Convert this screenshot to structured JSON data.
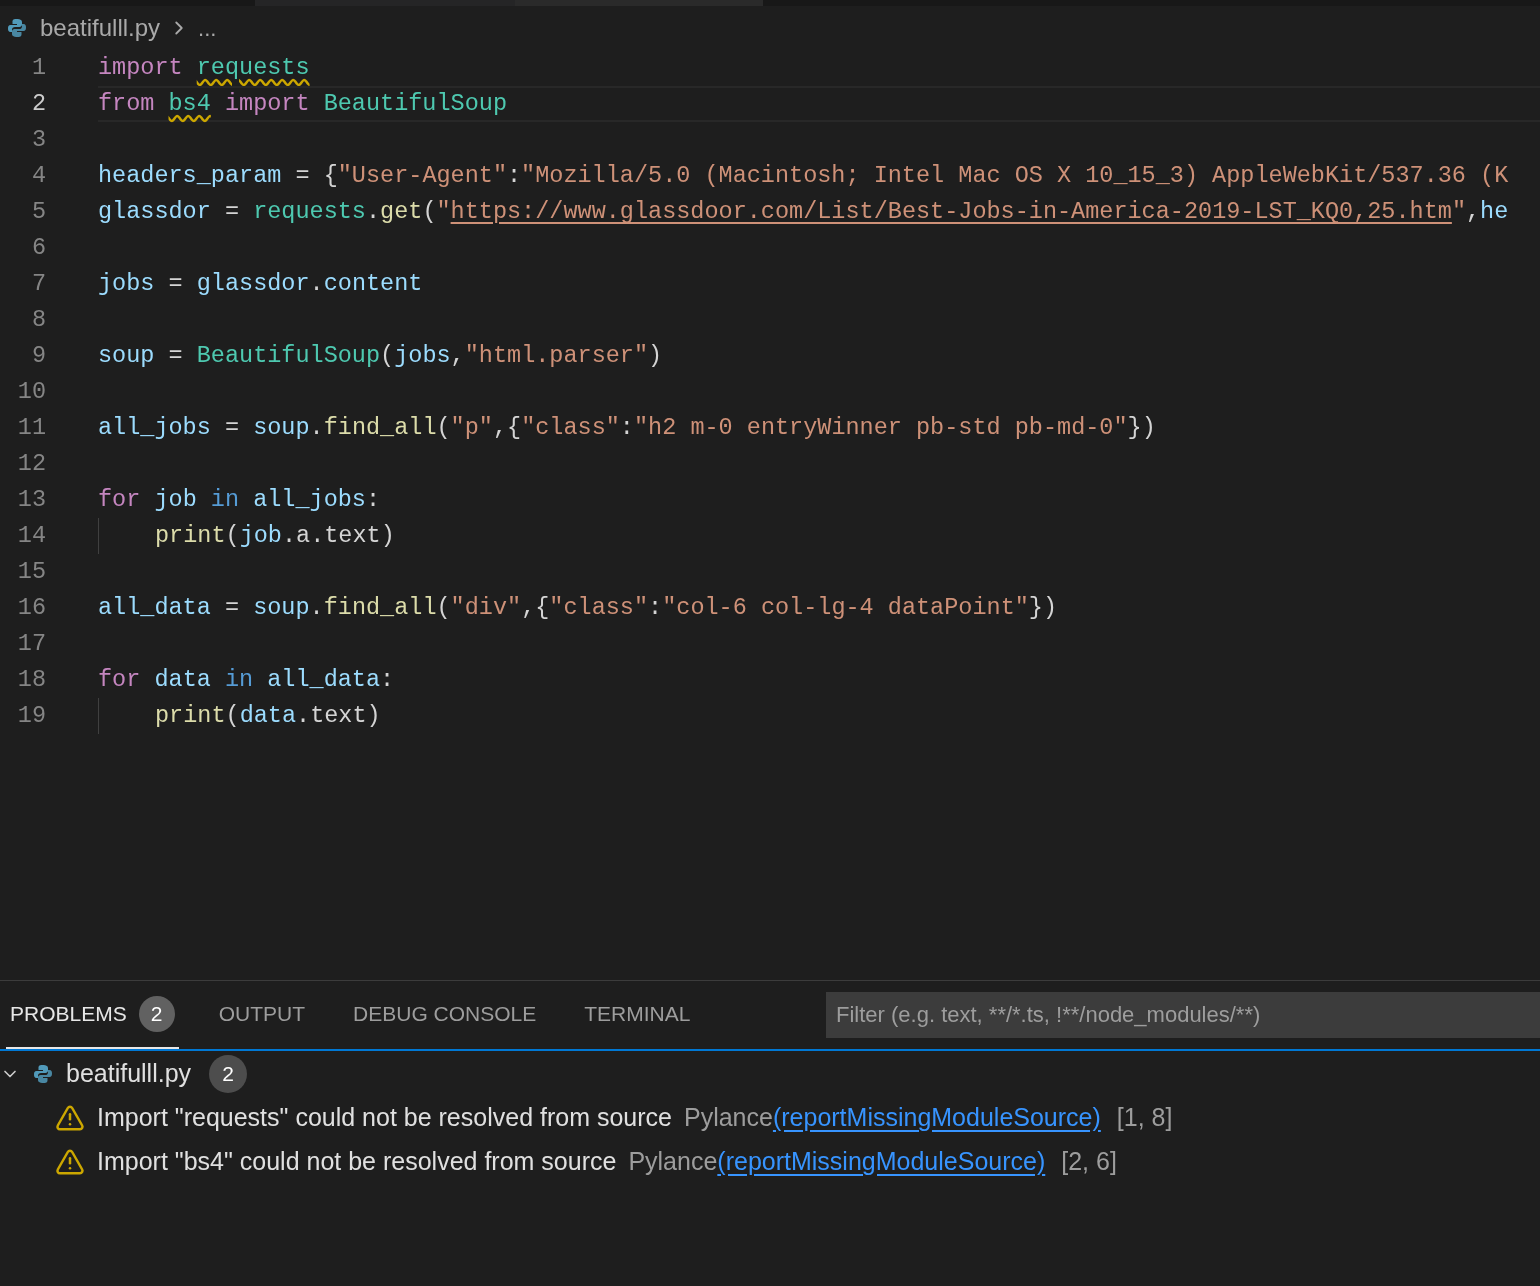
{
  "breadcrumb": {
    "file": "beatifulll.py",
    "more": "..."
  },
  "editor": {
    "lines": [
      {
        "number": "1",
        "current": false,
        "indented": false,
        "tokens": [
          {
            "kind": "keyword",
            "text": "import "
          },
          {
            "kind": "module",
            "text": "requests",
            "warning": true
          }
        ]
      },
      {
        "number": "2",
        "current": true,
        "indented": false,
        "tokens": [
          {
            "kind": "keyword",
            "text": "from "
          },
          {
            "kind": "module",
            "text": "bs4",
            "warning": true
          },
          {
            "kind": "keyword",
            "text": " import "
          },
          {
            "kind": "class",
            "text": "BeautifulSoup"
          }
        ]
      },
      {
        "number": "3",
        "current": false,
        "indented": false
      },
      {
        "number": "4",
        "current": false,
        "indented": false,
        "tokens": [
          {
            "kind": "variable",
            "text": "headers_param"
          },
          {
            "kind": "plain",
            "text": " = {"
          },
          {
            "kind": "string",
            "text": "\"User-Agent\""
          },
          {
            "kind": "plain",
            "text": ":"
          },
          {
            "kind": "string",
            "text": "\"Mozilla/5.0 (Macintosh; Intel Mac OS X 10_15_3) AppleWebKit/537.36 (K"
          }
        ]
      },
      {
        "number": "5",
        "current": false,
        "indented": false,
        "tokens": [
          {
            "kind": "variable",
            "text": "glassdor"
          },
          {
            "kind": "plain",
            "text": " = "
          },
          {
            "kind": "module",
            "text": "requests"
          },
          {
            "kind": "plain",
            "text": "."
          },
          {
            "kind": "function",
            "text": "get"
          },
          {
            "kind": "plain",
            "text": "("
          },
          {
            "kind": "string",
            "text": "\""
          },
          {
            "kind": "link",
            "text": "https://www.glassdoor.com/List/Best-Jobs-in-America-2019-LST_KQ0,25.htm"
          },
          {
            "kind": "string",
            "text": "\""
          },
          {
            "kind": "plain",
            "text": ","
          },
          {
            "kind": "variable",
            "text": "he"
          }
        ]
      },
      {
        "number": "6",
        "current": false,
        "indented": false
      },
      {
        "number": "7",
        "current": false,
        "indented": false,
        "tokens": [
          {
            "kind": "variable",
            "text": "jobs"
          },
          {
            "kind": "plain",
            "text": " = "
          },
          {
            "kind": "variable",
            "text": "glassdor"
          },
          {
            "kind": "plain",
            "text": "."
          },
          {
            "kind": "variable",
            "text": "content"
          }
        ]
      },
      {
        "number": "8",
        "current": false,
        "indented": false
      },
      {
        "number": "9",
        "current": false,
        "indented": false,
        "tokens": [
          {
            "kind": "variable",
            "text": "soup"
          },
          {
            "kind": "plain",
            "text": " = "
          },
          {
            "kind": "class",
            "text": "BeautifulSoup"
          },
          {
            "kind": "plain",
            "text": "("
          },
          {
            "kind": "variable",
            "text": "jobs"
          },
          {
            "kind": "plain",
            "text": ","
          },
          {
            "kind": "string",
            "text": "\"html.parser\""
          },
          {
            "kind": "plain",
            "text": ")"
          }
        ]
      },
      {
        "number": "10",
        "current": false,
        "indented": false
      },
      {
        "number": "11",
        "current": false,
        "indented": false,
        "tokens": [
          {
            "kind": "variable",
            "text": "all_jobs"
          },
          {
            "kind": "plain",
            "text": " = "
          },
          {
            "kind": "variable",
            "text": "soup"
          },
          {
            "kind": "plain",
            "text": "."
          },
          {
            "kind": "function",
            "text": "find_all"
          },
          {
            "kind": "plain",
            "text": "("
          },
          {
            "kind": "string",
            "text": "\"p\""
          },
          {
            "kind": "plain",
            "text": ",{"
          },
          {
            "kind": "string",
            "text": "\"class\""
          },
          {
            "kind": "plain",
            "text": ":"
          },
          {
            "kind": "string",
            "text": "\"h2 m-0 entryWinner pb-std pb-md-0\""
          },
          {
            "kind": "plain",
            "text": "})"
          }
        ]
      },
      {
        "number": "12",
        "current": false,
        "indented": false
      },
      {
        "number": "13",
        "current": false,
        "indented": false,
        "tokens": [
          {
            "kind": "keyword",
            "text": "for "
          },
          {
            "kind": "variable",
            "text": "job "
          },
          {
            "kind": "operator",
            "text": "in "
          },
          {
            "kind": "variable",
            "text": "all_jobs"
          },
          {
            "kind": "plain",
            "text": ":"
          }
        ]
      },
      {
        "number": "14",
        "current": false,
        "indented": true,
        "tokens": [
          {
            "kind": "function",
            "text": "print"
          },
          {
            "kind": "plain",
            "text": "("
          },
          {
            "kind": "variable",
            "text": "job"
          },
          {
            "kind": "plain",
            "text": ".a.text)"
          }
        ]
      },
      {
        "number": "15",
        "current": false,
        "indented": false
      },
      {
        "number": "16",
        "current": false,
        "indented": false,
        "tokens": [
          {
            "kind": "variable",
            "text": "all_data"
          },
          {
            "kind": "plain",
            "text": " = "
          },
          {
            "kind": "variable",
            "text": "soup"
          },
          {
            "kind": "plain",
            "text": "."
          },
          {
            "kind": "function",
            "text": "find_all"
          },
          {
            "kind": "plain",
            "text": "("
          },
          {
            "kind": "string",
            "text": "\"div\""
          },
          {
            "kind": "plain",
            "text": ",{"
          },
          {
            "kind": "string",
            "text": "\"class\""
          },
          {
            "kind": "plain",
            "text": ":"
          },
          {
            "kind": "string",
            "text": "\"col-6 col-lg-4 dataPoint\""
          },
          {
            "kind": "plain",
            "text": "})"
          }
        ]
      },
      {
        "number": "17",
        "current": false,
        "indented": false
      },
      {
        "number": "18",
        "current": false,
        "indented": false,
        "tokens": [
          {
            "kind": "keyword",
            "text": "for "
          },
          {
            "kind": "variable",
            "text": "data "
          },
          {
            "kind": "operator",
            "text": "in "
          },
          {
            "kind": "variable",
            "text": "all_data"
          },
          {
            "kind": "plain",
            "text": ":"
          }
        ]
      },
      {
        "number": "19",
        "current": false,
        "indented": true,
        "tokens": [
          {
            "kind": "function",
            "text": "print"
          },
          {
            "kind": "plain",
            "text": "("
          },
          {
            "kind": "variable",
            "text": "data"
          },
          {
            "kind": "plain",
            "text": ".text)"
          }
        ]
      }
    ]
  },
  "panel": {
    "tabs": [
      {
        "label": "PROBLEMS",
        "badge": "2",
        "selected": true
      },
      {
        "label": "OUTPUT",
        "selected": false
      },
      {
        "label": "DEBUG CONSOLE",
        "selected": false
      },
      {
        "label": "TERMINAL",
        "selected": false
      }
    ],
    "filter": {
      "placeholder": "Filter (e.g. text, **/*.ts, !**/node_modules/**)"
    },
    "file": {
      "name": "beatifulll.py",
      "count": "2",
      "expanded": true,
      "problems": [
        {
          "message": "Import \"requests\" could not be resolved from source",
          "source": "Pylance",
          "code": "(reportMissingModuleSource)",
          "position": "[1, 8]"
        },
        {
          "message": "Import \"bs4\" could not be resolved from source",
          "source": "Pylance",
          "code": "(reportMissingModuleSource)",
          "position": "[2, 6]"
        }
      ]
    }
  }
}
